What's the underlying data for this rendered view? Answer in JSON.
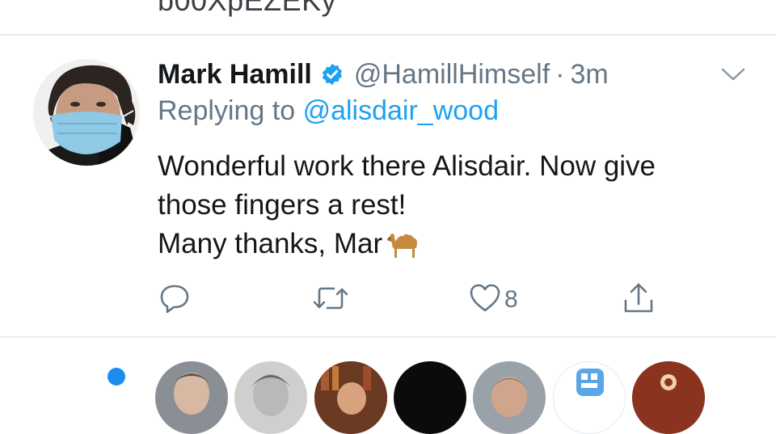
{
  "previous_tweet": {
    "text_tail": "b00XpEZEKy"
  },
  "tweet": {
    "author": {
      "name": "Mark Hamill",
      "handle": "@HamillHimself",
      "verified_icon": "verified-badge-icon",
      "avatar": "profile-photo"
    },
    "separator": "·",
    "time": "3m",
    "replying_to": {
      "prefix": "Replying to",
      "handle": "@alisdair_wood"
    },
    "text_lines": [
      "Wonderful work there Alisdair. Now give",
      "those fingers a rest!",
      "Many thanks, Mar"
    ],
    "inline_emoji": "camel-emoji",
    "actions": {
      "reply": {
        "icon": "reply-icon"
      },
      "retweet": {
        "icon": "retweet-icon"
      },
      "like": {
        "icon": "heart-icon",
        "count": "8"
      },
      "share": {
        "icon": "share-icon"
      }
    },
    "menu_icon": "chevron-down-icon"
  },
  "colors": {
    "accent": "#1da1f2",
    "secondary_text": "#657786",
    "primary_text": "#14171a",
    "divider": "#e6ecf0"
  }
}
